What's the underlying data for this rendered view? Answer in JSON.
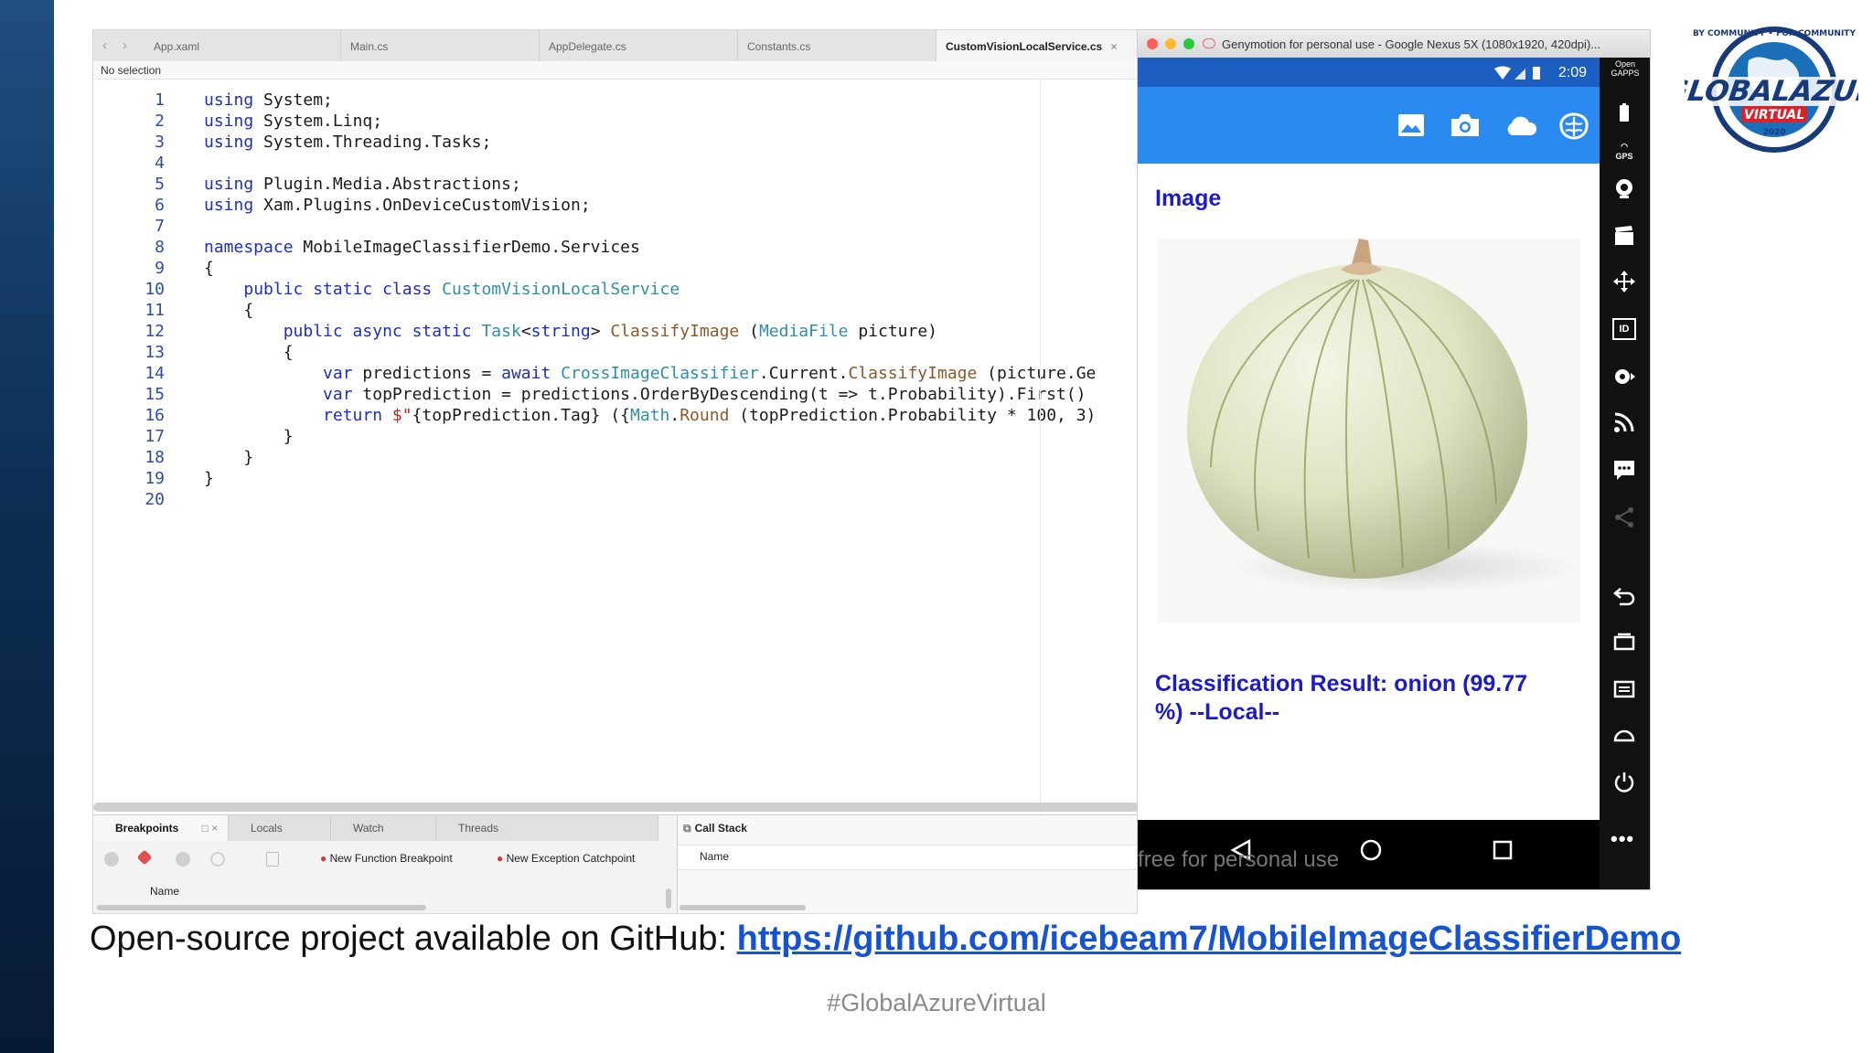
{
  "ide": {
    "tabs": [
      "App.xaml",
      "Main.cs",
      "AppDelegate.cs",
      "Constants.cs",
      "CustomVisionLocalService.cs"
    ],
    "selection_label": "No selection",
    "code_lines": [
      {
        "n": "1",
        "segs": [
          [
            "kw",
            "using"
          ],
          [
            "",
            "System;"
          ]
        ]
      },
      {
        "n": "2",
        "segs": [
          [
            "kw",
            "using"
          ],
          [
            "",
            "System.Linq;"
          ]
        ]
      },
      {
        "n": "3",
        "segs": [
          [
            "kw",
            "using"
          ],
          [
            "",
            "System.Threading.Tasks;"
          ]
        ]
      },
      {
        "n": "4",
        "segs": []
      },
      {
        "n": "5",
        "segs": [
          [
            "kw",
            "using"
          ],
          [
            "",
            "Plugin.Media.Abstractions;"
          ]
        ]
      },
      {
        "n": "6",
        "segs": [
          [
            "kw",
            "using"
          ],
          [
            "",
            "Xam.Plugins.OnDeviceCustomVision;"
          ]
        ]
      },
      {
        "n": "7",
        "segs": []
      },
      {
        "n": "8",
        "segs": [
          [
            "kw",
            "namespace"
          ],
          [
            "",
            "MobileImageClassifierDemo.Services"
          ]
        ]
      },
      {
        "n": "9",
        "segs": [
          [
            "",
            "{"
          ]
        ]
      },
      {
        "n": "10",
        "segs": [
          [
            "",
            "    "
          ],
          [
            "kw",
            "public static class"
          ],
          [
            "ty",
            "CustomVisionLocalService"
          ]
        ]
      },
      {
        "n": "11",
        "segs": [
          [
            "",
            "    {"
          ]
        ]
      },
      {
        "n": "12",
        "segs": [
          [
            "",
            "        "
          ],
          [
            "kw",
            "public async static"
          ],
          [
            "ty",
            "Task"
          ],
          [
            "",
            "<"
          ],
          [
            "kw",
            "string"
          ],
          [
            "",
            "> "
          ],
          [
            "me",
            "ClassifyImage"
          ],
          [
            "",
            "("
          ],
          [
            "ty",
            "MediaFile"
          ],
          [
            "",
            "picture)"
          ]
        ]
      },
      {
        "n": "13",
        "segs": [
          [
            "",
            "        {"
          ]
        ]
      },
      {
        "n": "14",
        "segs": [
          [
            "",
            "            "
          ],
          [
            "kw",
            "var"
          ],
          [
            "",
            "predictions = "
          ],
          [
            "kw",
            "await"
          ],
          [
            "ty",
            "CrossImageClassifier"
          ],
          [
            "",
            ".Current."
          ],
          [
            "me",
            "ClassifyImage"
          ],
          [
            "",
            "(picture.Ge"
          ]
        ]
      },
      {
        "n": "15",
        "segs": [
          [
            "",
            "            "
          ],
          [
            "kw",
            "var"
          ],
          [
            "",
            "topPrediction = predictions.OrderByDescending(t => t.Probability).First()"
          ]
        ]
      },
      {
        "n": "16",
        "segs": [
          [
            "",
            "            "
          ],
          [
            "kw",
            "return"
          ],
          [
            "st",
            "$\""
          ],
          [
            "",
            "{topPrediction.Tag} ({"
          ],
          [
            "ty",
            "Math"
          ],
          [
            "",
            "."
          ],
          [
            "me",
            "Round"
          ],
          [
            "",
            "(topPrediction.Probability * 100, 3)"
          ]
        ]
      },
      {
        "n": "17",
        "segs": [
          [
            "",
            "        }"
          ]
        ]
      },
      {
        "n": "18",
        "segs": [
          [
            "",
            "    }"
          ]
        ]
      },
      {
        "n": "19",
        "segs": [
          [
            "",
            "}"
          ]
        ]
      },
      {
        "n": "20",
        "segs": []
      }
    ],
    "debug_tabs": [
      "Breakpoints",
      "Locals",
      "Watch",
      "Threads"
    ],
    "callstack_label": "Call Stack",
    "new_function_breakpoint": "New Function Breakpoint",
    "new_exception_catchpoint": "New Exception Catchpoint",
    "name_col": "Name",
    "callstack_name_col": "Name"
  },
  "emulator": {
    "title": "Genymotion for personal use - Google Nexus 5X (1080x1920, 420dpi)...",
    "clock": "2:09",
    "page_title": "Image",
    "result": "Classification Result: onion (99.77 %) --Local--",
    "watermark": "free for personal use",
    "sidebar_top_label": "Open GAPPS",
    "gps_label": "GPS",
    "id_label": "ID"
  },
  "logo": {
    "main": "#GLOBALAZURE",
    "sub": "VIRTUAL",
    "year": "2020",
    "ring": "BY COMMUNITY • FOR COMMUNITY"
  },
  "caption": {
    "prefix": "Open-source project available on GitHub: ",
    "link": "https://github.com/icebeam7/MobileImageClassifierDemo"
  },
  "footer_tag": "#GlobalAzureVirtual",
  "colors": {
    "accent_blue": "#2b8af0",
    "result_text": "#1b1bc7",
    "link": "#1552d4"
  }
}
